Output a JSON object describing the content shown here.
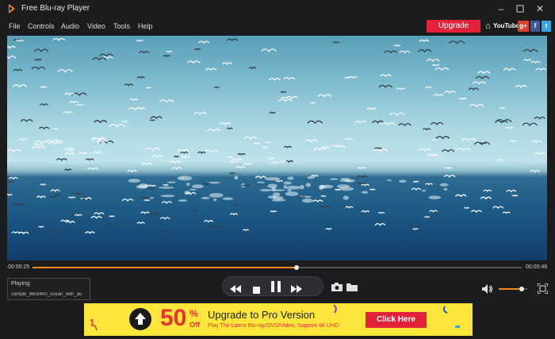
{
  "window": {
    "title": "Free Blu-ray Player"
  },
  "menu": {
    "items": [
      "File",
      "Controls",
      "Audio",
      "Video",
      "Tools",
      "Help"
    ]
  },
  "header": {
    "upgrade_label": "Upgrade",
    "social": [
      {
        "name": "home-icon",
        "text": "⌂",
        "color": "#2f6fd0"
      },
      {
        "name": "youtube-icon",
        "text": "YouTube",
        "color": "#e3223a"
      },
      {
        "name": "google-plus-icon",
        "text": "g+",
        "color": "#d9412d"
      },
      {
        "name": "facebook-icon",
        "text": "f",
        "color": "#3b5998"
      },
      {
        "name": "twitter-icon",
        "text": "t",
        "color": "#3aa3e0"
      }
    ]
  },
  "player": {
    "current_time": "00:00:25",
    "total_time": "00:00:46",
    "progress_fraction": 0.54,
    "playing_label": "Playing:",
    "playing_file": "sample_960x400_ocean_with_au",
    "volume_fraction": 0.8
  },
  "ad": {
    "percent": "50",
    "percent_sign": "%",
    "off": "Off",
    "title": "Upgrade to Pro Version",
    "subtitle": "Play The Latest Blu-ray/DVD/Video, Support 4K UHD",
    "cta": "Click Here"
  },
  "colors": {
    "accent": "#ef8a1f",
    "upgrade": "#e3223a",
    "ad_bg": "#fce63b"
  }
}
